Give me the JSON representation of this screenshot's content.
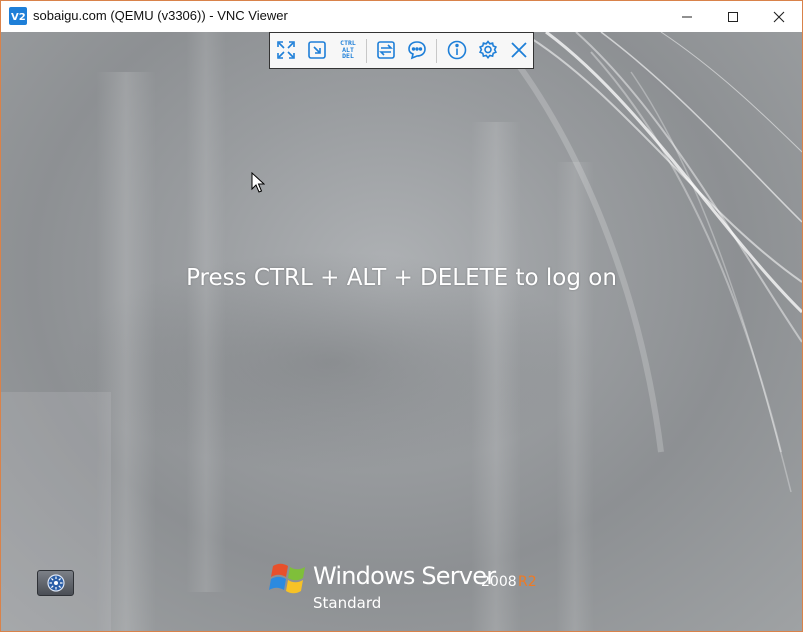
{
  "window": {
    "title": "sobaigu.com (QEMU (v3306)) - VNC Viewer",
    "app_icon": "vnc-viewer-icon",
    "controls": [
      "minimize-icon",
      "maximize-icon",
      "close-icon"
    ],
    "border_color": "#d9824a"
  },
  "toolbar": {
    "buttons": [
      {
        "name": "fullscreen",
        "icon": "fullscreen-icon"
      },
      {
        "name": "scale",
        "icon": "scale-icon"
      },
      {
        "name": "ctrl-alt-del",
        "icon": "ctrl-alt-del-icon",
        "lines": [
          "CTRL",
          "ALT",
          "DEL"
        ]
      },
      {
        "name": "transfer-files",
        "icon": "transfer-icon"
      },
      {
        "name": "chat",
        "icon": "chat-icon"
      },
      {
        "name": "info",
        "icon": "info-icon"
      },
      {
        "name": "settings",
        "icon": "gear-icon"
      },
      {
        "name": "close-toolbar",
        "icon": "close-icon"
      }
    ],
    "accent_color": "#1e7fd8"
  },
  "remote_screen": {
    "logon_message": "Press CTRL + ALT + DELETE to log on",
    "ease_of_access_icon": "ease-of-access-icon",
    "branding": {
      "product": "Windows Server",
      "version": "2008",
      "release": "R2",
      "edition": "Standard",
      "release_color": "#f07a23"
    }
  }
}
